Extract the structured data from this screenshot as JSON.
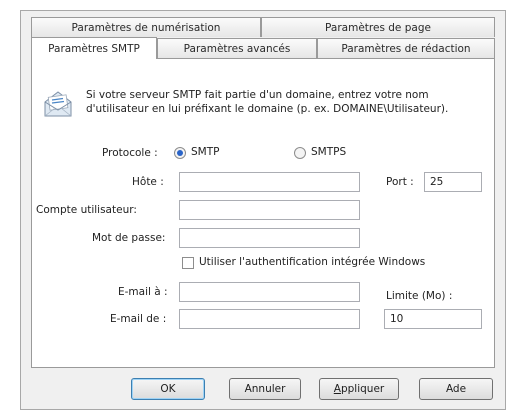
{
  "tabs_back": [
    "Paramètres de numérisation",
    "Paramètres de page"
  ],
  "tabs_front": [
    "Paramètres SMTP",
    "Paramètres avancés",
    "Paramètres de rédaction"
  ],
  "info": {
    "line1": "Si votre serveur SMTP fait partie d'un domaine, entrez votre nom",
    "line2": "d'utilisateur en lui préfixant le domaine (p. ex. DOMAINE\\Utilisateur).",
    "icon": "mail-envelope-icon"
  },
  "protocol": {
    "label": "Protocole :",
    "options": [
      "SMTP",
      "SMTPS"
    ],
    "selected": "SMTP"
  },
  "host": {
    "label": "Hôte :",
    "value": ""
  },
  "port": {
    "label": "Port :",
    "value": "25"
  },
  "account": {
    "label": "Compte utilisateur:",
    "value": ""
  },
  "password": {
    "label": "Mot de passe:",
    "value": ""
  },
  "windows_auth": {
    "label": "Utiliser l'authentification intégrée Windows",
    "checked": false
  },
  "email_to": {
    "label": "E-mail à :",
    "value": ""
  },
  "email_from": {
    "label": "E-mail de :",
    "value": ""
  },
  "limit": {
    "label": "Limite (Mo) :",
    "value": "10"
  },
  "buttons": {
    "ok": "OK",
    "cancel": "Annuler",
    "apply_first": "A",
    "apply_rest": "ppliquer",
    "help": "Ade"
  }
}
